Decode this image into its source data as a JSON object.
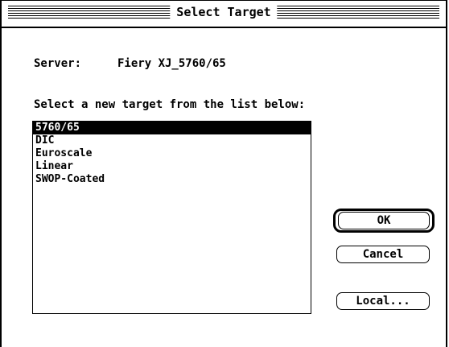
{
  "window": {
    "title": "Select Target"
  },
  "server": {
    "label": "Server:",
    "value": "Fiery XJ_5760/65"
  },
  "prompt": "Select a new target from the list below:",
  "targets": {
    "items": [
      {
        "label": "5760/65",
        "selected": true
      },
      {
        "label": "DIC",
        "selected": false
      },
      {
        "label": "Euroscale",
        "selected": false
      },
      {
        "label": "Linear",
        "selected": false
      },
      {
        "label": "SWOP-Coated",
        "selected": false
      }
    ]
  },
  "buttons": {
    "ok": "OK",
    "cancel": "Cancel",
    "local": "Local..."
  }
}
